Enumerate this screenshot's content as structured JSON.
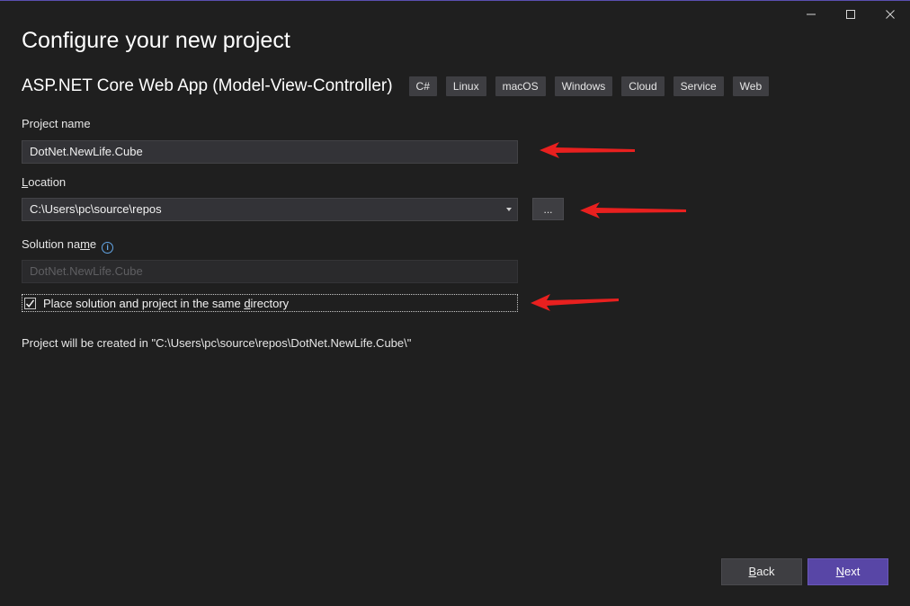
{
  "window": {
    "title": "Configure your new project",
    "controls": {
      "minimize": "minimize-icon",
      "maximize": "maximize-icon",
      "close": "close-icon"
    }
  },
  "template": {
    "name": "ASP.NET Core Web App (Model-View-Controller)",
    "tags": [
      "C#",
      "Linux",
      "macOS",
      "Windows",
      "Cloud",
      "Service",
      "Web"
    ]
  },
  "project_name": {
    "label": "Project name",
    "value": "DotNet.NewLife.Cube"
  },
  "location": {
    "label_prefix": "",
    "label_access_key": "L",
    "label_rest": "ocation",
    "value": "C:\\Users\\pc\\source\\repos",
    "browse_label": "..."
  },
  "solution_name": {
    "label_prefix": "Solution na",
    "label_access_key": "m",
    "label_rest": "e",
    "value": "DotNet.NewLife.Cube",
    "info_icon": "info-icon"
  },
  "same_directory": {
    "label_prefix": "Place solution and project in the same ",
    "label_access_key": "d",
    "label_rest": "irectory",
    "checked": true
  },
  "result_text": "Project will be created in \"C:\\Users\\pc\\source\\repos\\DotNet.NewLife.Cube\\\"",
  "footer": {
    "back_key": "B",
    "back_rest": "ack",
    "next_key": "N",
    "next_rest": "ext"
  },
  "colors": {
    "background": "#1f1f1f",
    "accent": "#5846a6",
    "annotation_arrow": "#e8201f"
  }
}
